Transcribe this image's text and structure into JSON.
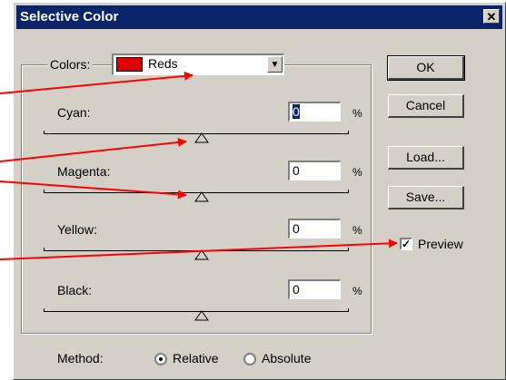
{
  "dialog": {
    "title": "Selective Color",
    "close_glyph": "✕"
  },
  "colors": {
    "label": "Colors:",
    "selected": "Reds",
    "swatch_color": "#e00000"
  },
  "adjustments": [
    {
      "label": "Cyan:",
      "value": "0",
      "unit": "%",
      "selected": true
    },
    {
      "label": "Magenta:",
      "value": "0",
      "unit": "%"
    },
    {
      "label": "Yellow:",
      "value": "0",
      "unit": "%"
    },
    {
      "label": "Black:",
      "value": "0",
      "unit": "%"
    }
  ],
  "buttons": {
    "ok": "OK",
    "cancel": "Cancel",
    "load": "Load...",
    "save": "Save..."
  },
  "preview": {
    "label": "Preview",
    "checked": true
  },
  "method": {
    "label": "Method:",
    "relative": "Relative",
    "absolute": "Absolute",
    "selected": "Relative"
  },
  "annotation_color": "#ff0000"
}
